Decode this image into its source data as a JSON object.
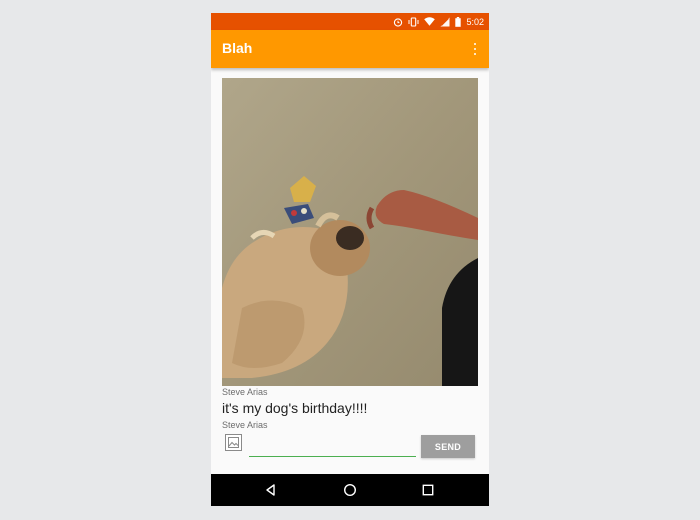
{
  "status_bar": {
    "time": "5:02",
    "icons": [
      "alarm-icon",
      "vibrate-icon",
      "wifi-icon",
      "signal-icon",
      "battery-icon"
    ]
  },
  "app_bar": {
    "title": "Blah",
    "menu_icon": "overflow-menu-icon"
  },
  "post": {
    "image_description": "dog-photo",
    "author": "Steve Arias",
    "message": "it's my dog's birthday!!!!",
    "reply_author": "Steve Arias"
  },
  "composer": {
    "attach_icon": "image-icon",
    "input_value": "",
    "input_placeholder": "",
    "send_label": "SEND"
  },
  "nav_bar": {
    "buttons": [
      "back-icon",
      "home-icon",
      "recents-icon"
    ]
  },
  "colors": {
    "status_bar": "#e65100",
    "app_bar": "#ff9800",
    "input_underline": "#4caf50",
    "send_button": "#9e9e9e"
  }
}
